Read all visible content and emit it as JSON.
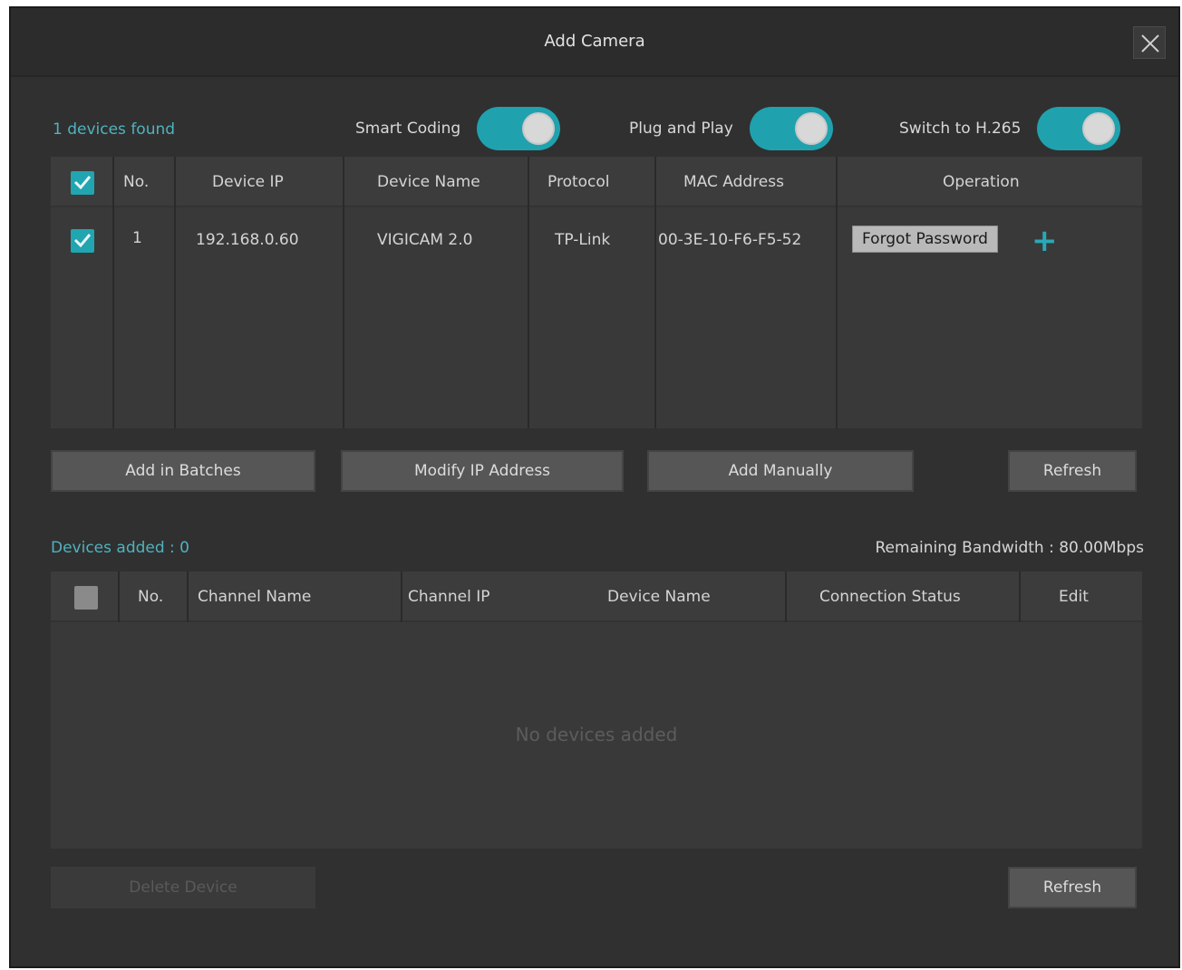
{
  "dialog": {
    "title": "Add Camera",
    "close_icon": "close-icon"
  },
  "top": {
    "devices_found": "1 devices found",
    "toggles": [
      {
        "label": "Smart Coding",
        "on": true
      },
      {
        "label": "Plug and Play",
        "on": true
      },
      {
        "label": "Switch to H.265",
        "on": true
      }
    ]
  },
  "found_table": {
    "headers": [
      "",
      "No.",
      "Device IP",
      "Device Name",
      "Protocol",
      "MAC Address",
      "Operation"
    ],
    "rows": [
      {
        "checked": true,
        "no": "1",
        "ip": "192.168.0.60",
        "name": "VIGICAM 2.0",
        "protocol": "TP-Link",
        "mac": "00-3E-10-F6-F5-52",
        "operation": "Forgot Password"
      }
    ]
  },
  "actions": {
    "add_in_batches": "Add in Batches",
    "modify_ip": "Modify IP Address",
    "add_manually": "Add Manually",
    "refresh": "Refresh"
  },
  "added": {
    "label": "Devices added : 0",
    "bandwidth": "Remaining Bandwidth : 80.00Mbps",
    "headers": [
      "",
      "No.",
      "Channel Name",
      "Channel IP",
      "Device Name",
      "Connection Status",
      "Edit"
    ],
    "empty_text": "No devices added",
    "delete_label": "Delete Device",
    "refresh_label": "Refresh"
  },
  "colors": {
    "accent": "#20a5b1",
    "accent_text": "#4fb3bf",
    "background": "#303030"
  }
}
